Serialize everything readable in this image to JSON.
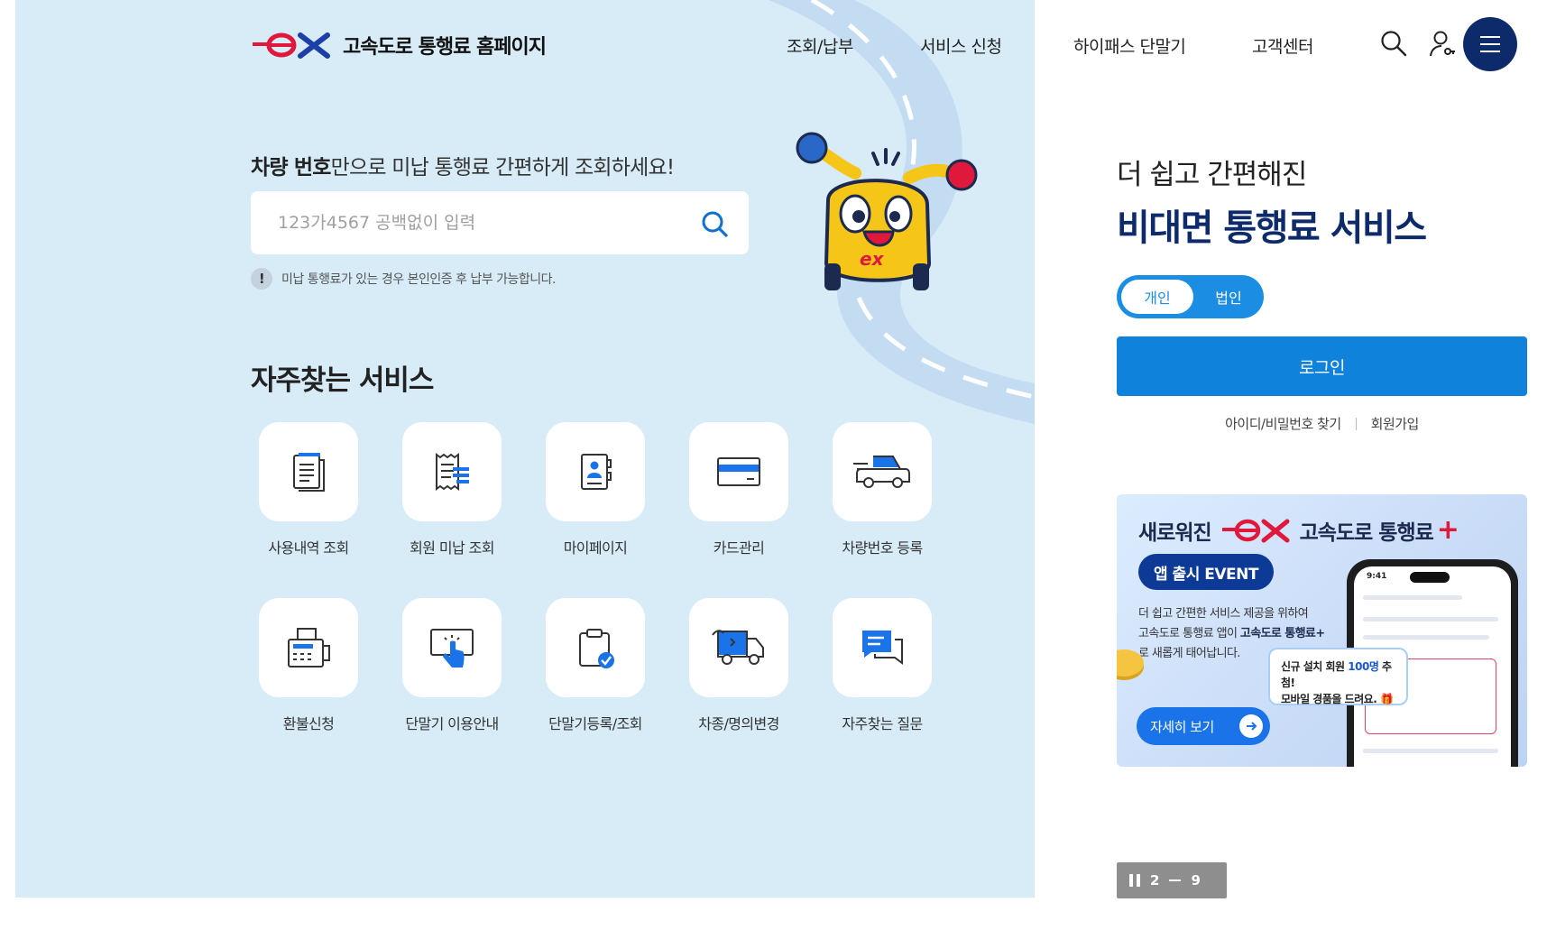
{
  "header": {
    "site_title": "고속도로 통행료 홈페이지",
    "logo_text": "ex",
    "nav": [
      "조회/납부",
      "서비스 신청",
      "하이패스 단말기",
      "고객센터"
    ]
  },
  "search": {
    "label_bold": "차량 번호",
    "label_rest": "만으로 미납 통행료 간편하게 조회하세요!",
    "placeholder": "123가4567 공백없이 입력",
    "notice": "미납 통행료가 있는 경우 본인인증 후 납부 가능합니다.",
    "notice_icon_text": "!"
  },
  "services": {
    "title": "자주찾는 서비스",
    "items": [
      {
        "label": "사용내역 조회",
        "icon": "receipt-list-icon"
      },
      {
        "label": "회원 미납 조회",
        "icon": "unpaid-bill-icon"
      },
      {
        "label": "마이페이지",
        "icon": "my-page-icon"
      },
      {
        "label": "카드관리",
        "icon": "card-icon"
      },
      {
        "label": "차량번호 등록",
        "icon": "car-icon"
      },
      {
        "label": "환불신청",
        "icon": "fax-refund-icon"
      },
      {
        "label": "단말기 이용안내",
        "icon": "touch-screen-icon"
      },
      {
        "label": "단말기등록/조회",
        "icon": "clipboard-check-icon"
      },
      {
        "label": "차종/명의변경",
        "icon": "truck-change-icon"
      },
      {
        "label": "자주찾는 질문",
        "icon": "chat-bubble-icon"
      }
    ]
  },
  "login_panel": {
    "subtitle": "더 쉽고 간편해진",
    "title": "비대면 통행료 서비스",
    "toggle": [
      "개인",
      "법인"
    ],
    "login_label": "로그인",
    "find_label": "아이디/비밀번호 찾기",
    "join_label": "회원가입"
  },
  "banner": {
    "headline_prefix": "새로워진",
    "logo_text": "ex",
    "headline_suffix": "고속도로 통행료",
    "plus": "+",
    "event_label": "앱 출시 EVENT",
    "desc_line1": "더 쉽고 간편한 서비스 제공을 위하여",
    "desc_line2_pre": "고속도로 통행료 앱이 ",
    "desc_line2_em": "고속도로 통행료+",
    "desc_line3": "로 새롭게 태어납니다.",
    "more_label": "자세히 보기",
    "phone_time": "9:41",
    "popup_line1_pre": "신규 설치 회원 ",
    "popup_line1_hl": "100명",
    "popup_line1_post": " 추첨!",
    "popup_line2": "모바일 경품을 드려요. 🎁"
  },
  "pager": {
    "current": "2",
    "total": "9"
  },
  "colors": {
    "navy": "#0d2a6b",
    "blue": "#0f82dc",
    "bg_left": "#d8ecf8",
    "accent_red": "#e0193c"
  }
}
